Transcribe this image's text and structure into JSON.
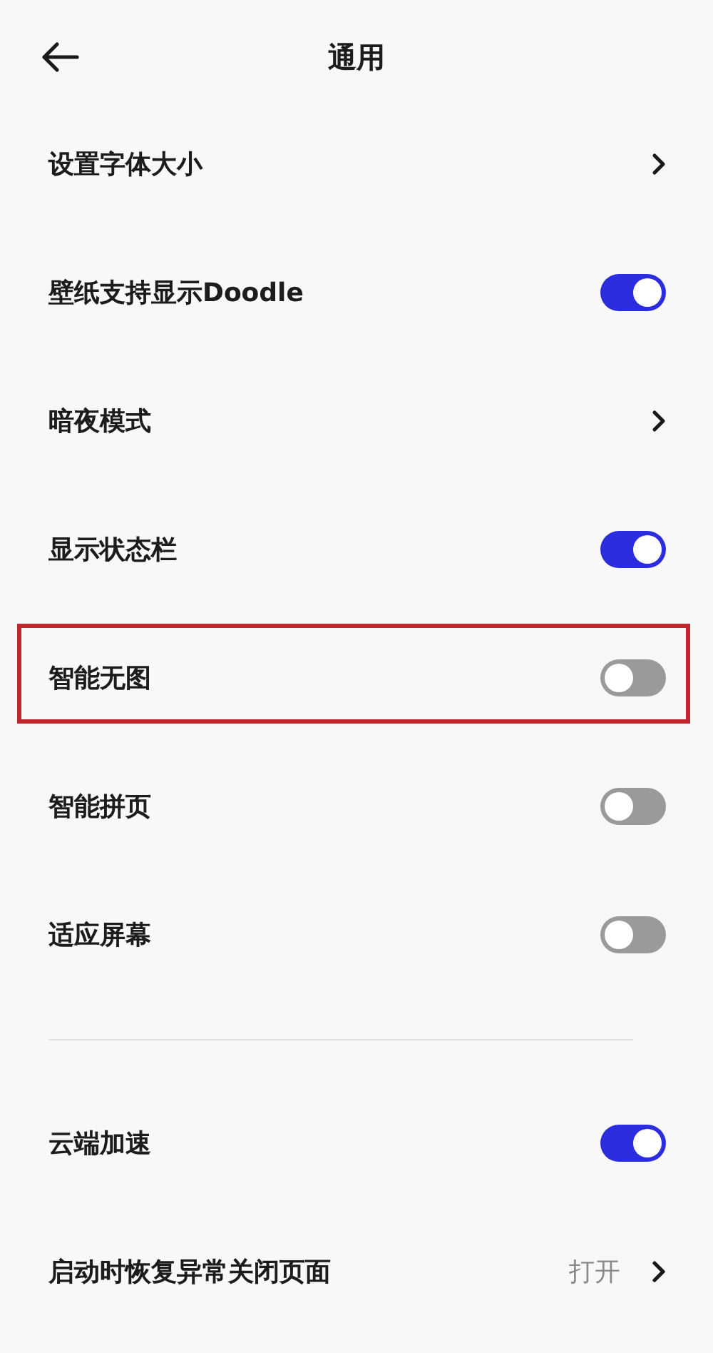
{
  "header": {
    "title": "通用"
  },
  "sections": [
    {
      "items": [
        {
          "kind": "link",
          "label": "设置字体大小",
          "highlighted": false
        },
        {
          "kind": "toggle",
          "label": "壁纸支持显示Doodle",
          "on": true,
          "highlighted": false
        },
        {
          "kind": "link",
          "label": "暗夜模式",
          "highlighted": false
        },
        {
          "kind": "toggle",
          "label": "显示状态栏",
          "on": true,
          "highlighted": false
        },
        {
          "kind": "toggle",
          "label": "智能无图",
          "on": false,
          "highlighted": true
        },
        {
          "kind": "toggle",
          "label": "智能拼页",
          "on": false,
          "highlighted": false
        },
        {
          "kind": "toggle",
          "label": "适应屏幕",
          "on": false,
          "highlighted": false
        }
      ]
    },
    {
      "items": [
        {
          "kind": "toggle",
          "label": "云端加速",
          "on": true,
          "highlighted": false
        },
        {
          "kind": "link",
          "label": "启动时恢复异常关闭页面",
          "value": "打开",
          "highlighted": false
        }
      ]
    }
  ]
}
